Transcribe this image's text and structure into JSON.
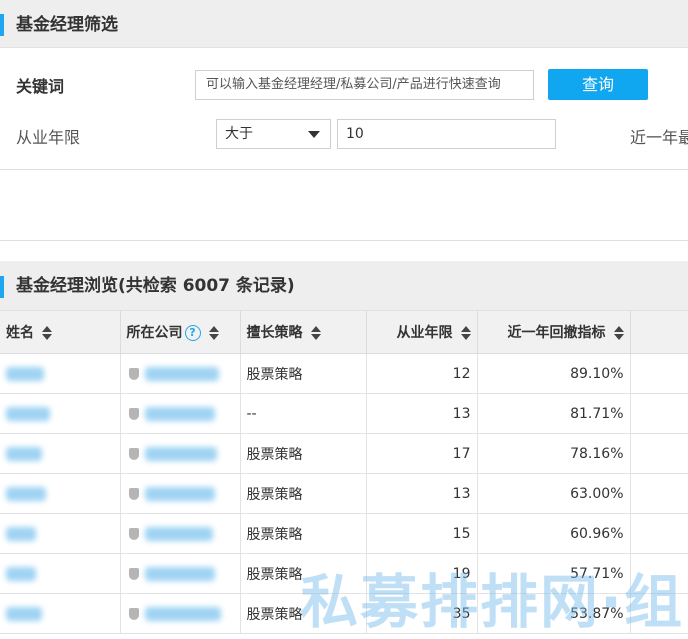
{
  "filter": {
    "title": "基金经理筛选",
    "keyword_label": "关键词",
    "keyword_placeholder": "可以输入基金经理经理/私募公司/产品进行快速查询",
    "search_button": "查询",
    "years_label": "从业年限",
    "compare_selected": "大于",
    "years_value": "10",
    "recent_label": "近一年最"
  },
  "browse": {
    "title": "基金经理浏览(共检索 6007 条记录)"
  },
  "table": {
    "headers": {
      "name": "姓名",
      "company": "所在公司",
      "strategy": "擅长策略",
      "years": "从业年限",
      "drawdown": "近一年回撤指标"
    },
    "help_glyph": "?",
    "rows": [
      {
        "strategy": "股票策略",
        "years": "12",
        "drawdown": "89.10%"
      },
      {
        "strategy": "--",
        "years": "13",
        "drawdown": "81.71%"
      },
      {
        "strategy": "股票策略",
        "years": "17",
        "drawdown": "78.16%"
      },
      {
        "strategy": "股票策略",
        "years": "13",
        "drawdown": "63.00%"
      },
      {
        "strategy": "股票策略",
        "years": "15",
        "drawdown": "60.96%"
      },
      {
        "strategy": "股票策略",
        "years": "19",
        "drawdown": "57.71%"
      },
      {
        "strategy": "股票策略",
        "years": "35",
        "drawdown": "53.87%"
      }
    ]
  },
  "watermark": "私募排排网·组",
  "colors": {
    "accent": "#1ea7f0",
    "button": "#10a6f0",
    "header_bg": "#eeeeee"
  }
}
